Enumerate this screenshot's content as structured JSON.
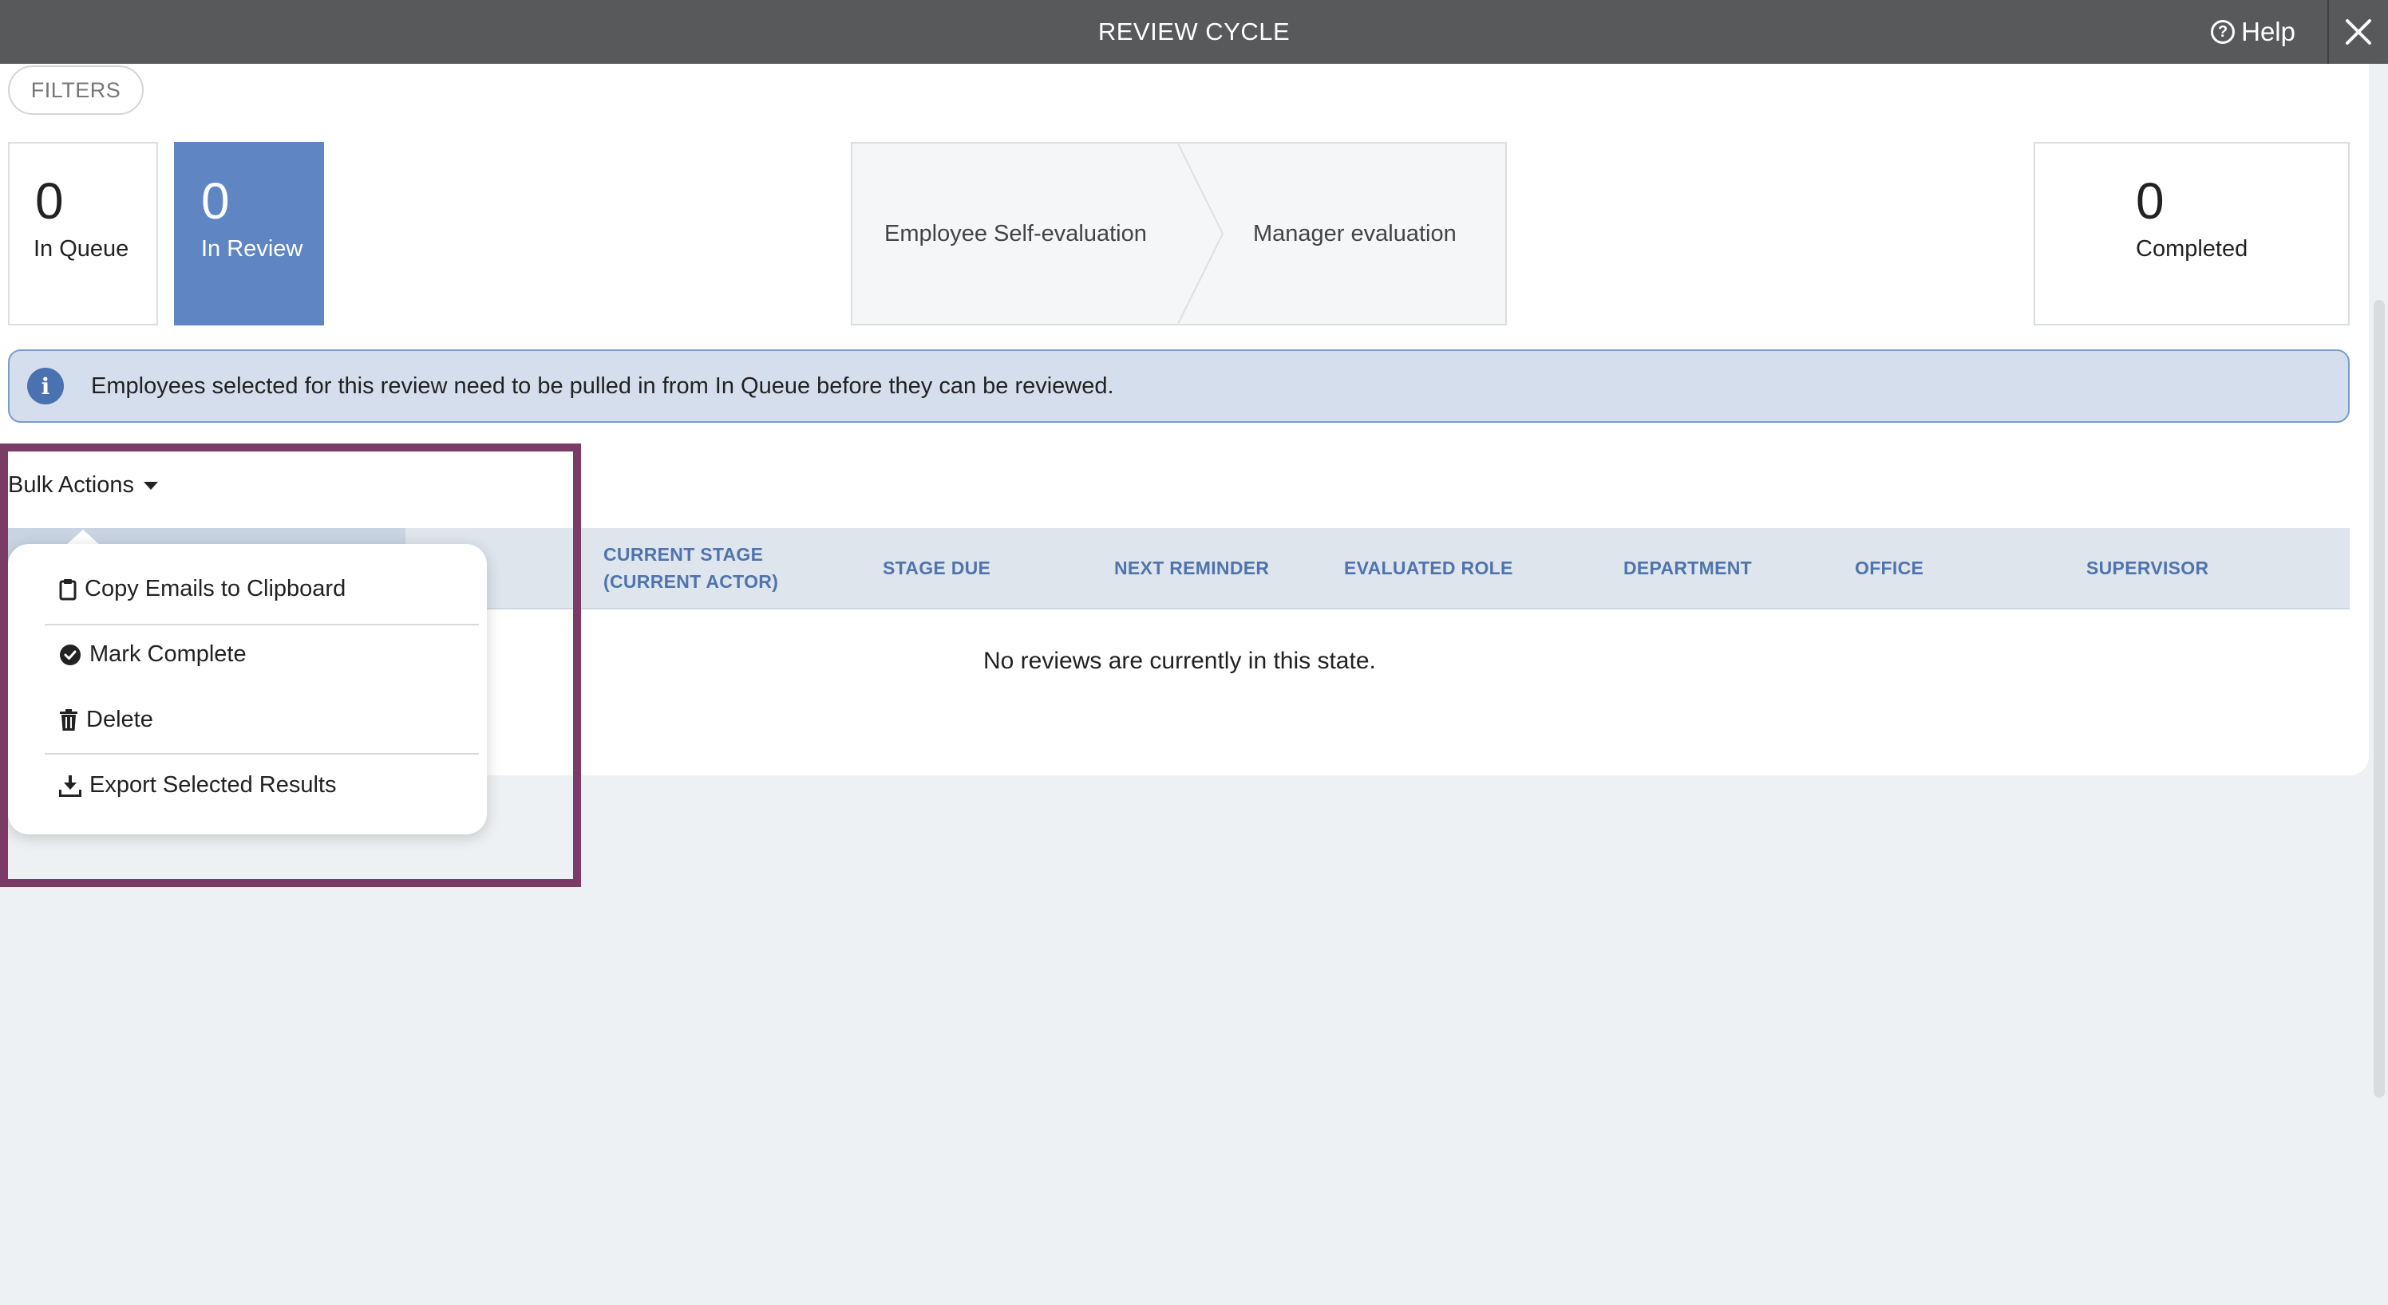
{
  "header": {
    "title": "REVIEW CYCLE",
    "help_label": "Help",
    "help_icon": "question-circle-icon",
    "close_icon": "close-icon"
  },
  "filters": {
    "label": "FILTERS"
  },
  "stats": {
    "in_queue": {
      "count": "0",
      "label": "In Queue"
    },
    "in_review": {
      "count": "0",
      "label": "In Review"
    },
    "completed": {
      "count": "0",
      "label": "Completed"
    }
  },
  "stages": [
    "Employee Self-evaluation",
    "Manager evaluation"
  ],
  "info_banner": {
    "text": "Employees selected for this review need to be pulled in from In Queue before they can be reviewed.",
    "icon": "info-icon"
  },
  "bulk_actions": {
    "label": "Bulk Actions",
    "items": [
      {
        "label": "Copy Emails to Clipboard",
        "icon": "clipboard-icon"
      },
      {
        "label": "Mark Complete",
        "icon": "check-circle-icon"
      },
      {
        "label": "Delete",
        "icon": "trash-icon"
      },
      {
        "label": "Export Selected Results",
        "icon": "download-icon"
      }
    ]
  },
  "table": {
    "columns": [
      "CURRENT STAGE",
      "(CURRENT ACTOR)",
      "STAGE DUE",
      "NEXT REMINDER",
      "EVALUATED ROLE",
      "DEPARTMENT",
      "OFFICE",
      "SUPERVISOR"
    ],
    "empty_message": "No reviews are currently in this state."
  },
  "colors": {
    "active_stat": "#5f86c2",
    "header_text": "#4f74ad",
    "highlight": "#7a3b66",
    "topbar": "#58595b"
  }
}
